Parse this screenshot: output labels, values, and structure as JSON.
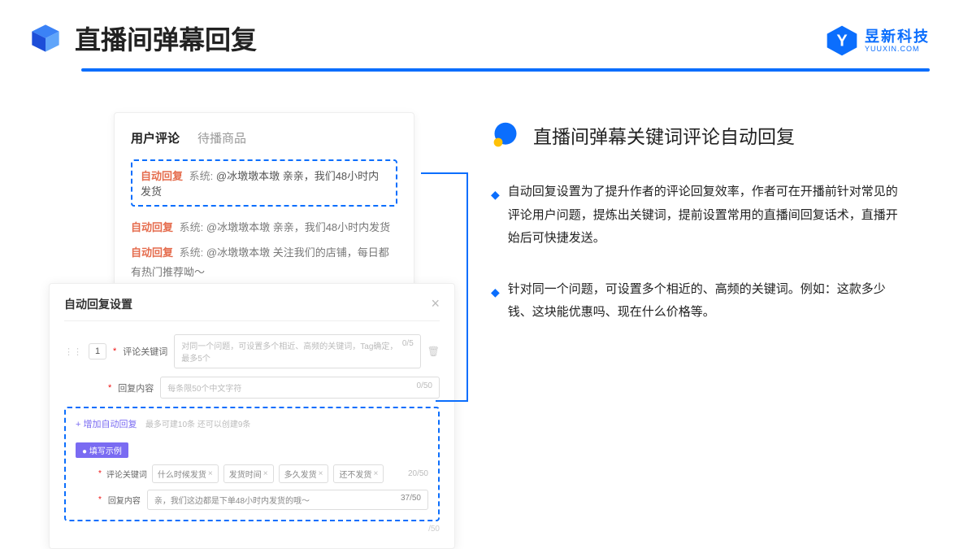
{
  "header": {
    "title": "直播间弹幕回复"
  },
  "brand": {
    "main": "昱新科技",
    "sub": "YUUXIN.COM"
  },
  "card1": {
    "tab1": "用户评论",
    "tab2": "待播商品",
    "hl_auto": "自动回复",
    "hl_sys": "系统:",
    "hl_text": "@冰墩墩本墩 亲亲，我们48小时内发货",
    "c2_auto": "自动回复",
    "c2_sys": "系统:",
    "c2_text": "@冰墩墩本墩 亲亲，我们48小时内发货",
    "c3_auto": "自动回复",
    "c3_sys": "系统:",
    "c3_text": "@冰墩墩本墩 关注我们的店铺，每日都有热门推荐呦～"
  },
  "card2": {
    "title": "自动回复设置",
    "close": "×",
    "num": "1",
    "lbl_kw": "评论关键词",
    "ph_kw": "对同一个问题，可设置多个相近、高频的关键词，Tag确定，最多5个",
    "cnt_kw": "0/5",
    "lbl_reply": "回复内容",
    "ph_reply": "每条限50个中文字符",
    "cnt_reply": "0/50",
    "add": "+ 增加自动回复",
    "hint": "最多可建10条 还可以创建9条",
    "badge": "● 填写示例",
    "ex_lbl_kw": "评论关键词",
    "chip1": "什么时候发货",
    "chip2": "发货时间",
    "chip3": "多久发货",
    "chip4": "还不发货",
    "ex_cnt_kw": "20/50",
    "ex_lbl_reply": "回复内容",
    "ex_reply": "亲，我们这边都是下单48小时内发货的哦～",
    "ex_cnt_reply": "37/50",
    "below": "/50"
  },
  "right": {
    "title": "直播间弹幕关键词评论自动回复",
    "b1": "自动回复设置为了提升作者的评论回复效率，作者可在开播前针对常见的评论用户问题，提炼出关键词，提前设置常用的直播间回复话术，直播开始后可快捷发送。",
    "b2": "针对同一个问题，可设置多个相近的、高频的关键词。例如：这款多少钱、这块能优惠吗、现在什么价格等。"
  }
}
